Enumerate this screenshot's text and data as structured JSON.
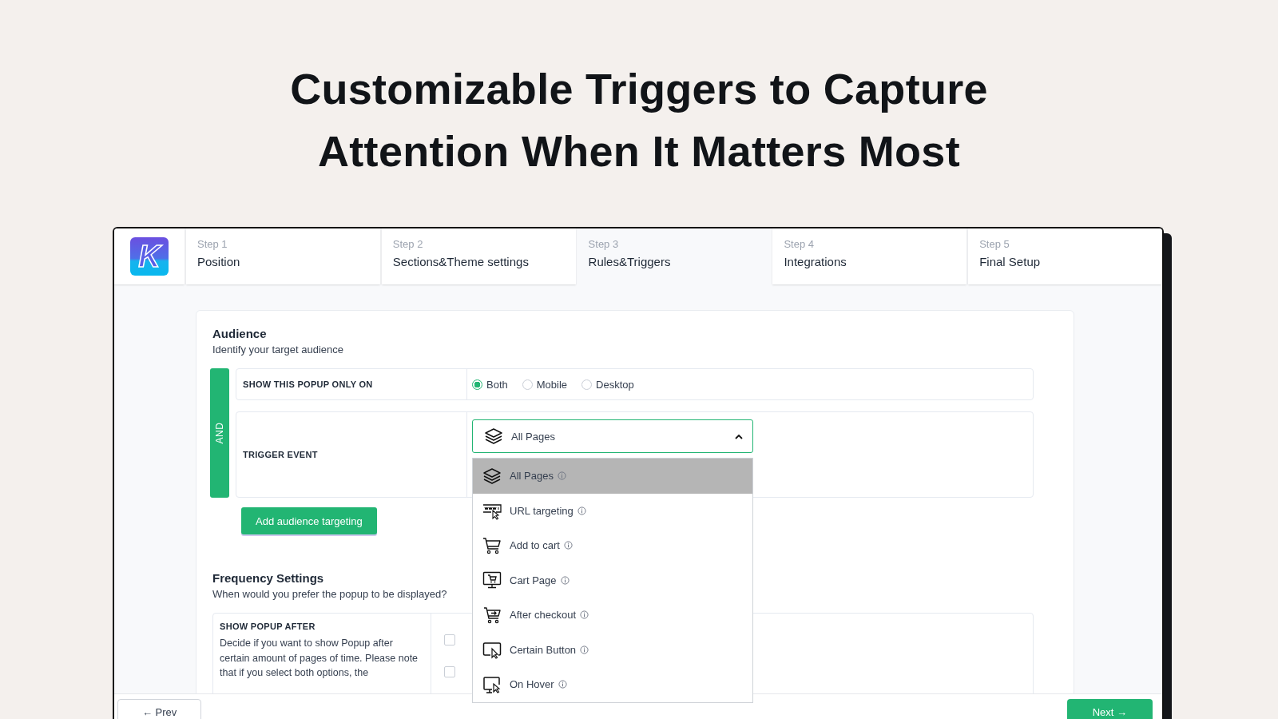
{
  "heading": "Customizable Triggers to Capture Attention When It Matters Most",
  "logo": "K",
  "steps": [
    {
      "step": "Step 1",
      "label": "Position",
      "selected": false
    },
    {
      "step": "Step 2",
      "label": "Sections&Theme settings",
      "selected": false
    },
    {
      "step": "Step 3",
      "label": "Rules&Triggers",
      "selected": true
    },
    {
      "step": "Step 4",
      "label": "Integrations",
      "selected": false
    },
    {
      "step": "Step 5",
      "label": "Final Setup",
      "selected": false
    }
  ],
  "audience": {
    "title": "Audience",
    "subtitle": "Identify your target audience",
    "connector": "AND",
    "device": {
      "label": "SHOW THIS POPUP ONLY ON",
      "options": [
        {
          "label": "Both",
          "selected": true
        },
        {
          "label": "Mobile",
          "selected": false
        },
        {
          "label": "Desktop",
          "selected": false
        }
      ]
    },
    "trigger": {
      "label": "TRIGGER EVENT",
      "value": "All Pages",
      "expanded": true,
      "options": [
        {
          "kind": "layers",
          "label": "All Pages",
          "selected": true
        },
        {
          "kind": "url",
          "label": "URL targeting",
          "selected": false
        },
        {
          "kind": "cart",
          "label": "Add to cart",
          "selected": false
        },
        {
          "kind": "cart-page",
          "label": "Cart Page",
          "selected": false
        },
        {
          "kind": "checkout",
          "label": "After checkout",
          "selected": false
        },
        {
          "kind": "button",
          "label": "Certain Button",
          "selected": false
        },
        {
          "kind": "hover",
          "label": "On Hover",
          "selected": false
        }
      ]
    },
    "add_button": "Add audience targeting"
  },
  "frequency": {
    "title": "Frequency Settings",
    "subtitle": "When would you prefer the popup to be displayed?",
    "rule": {
      "label": "SHOW POPUP AFTER",
      "description": "Decide if you want to show Popup after certain amount of pages of time. Please note that if you select both options, the",
      "checkboxes": [
        {
          "checked": false
        },
        {
          "checked": false
        }
      ]
    }
  },
  "footer": {
    "prev": "← Prev",
    "next": "Next →"
  }
}
